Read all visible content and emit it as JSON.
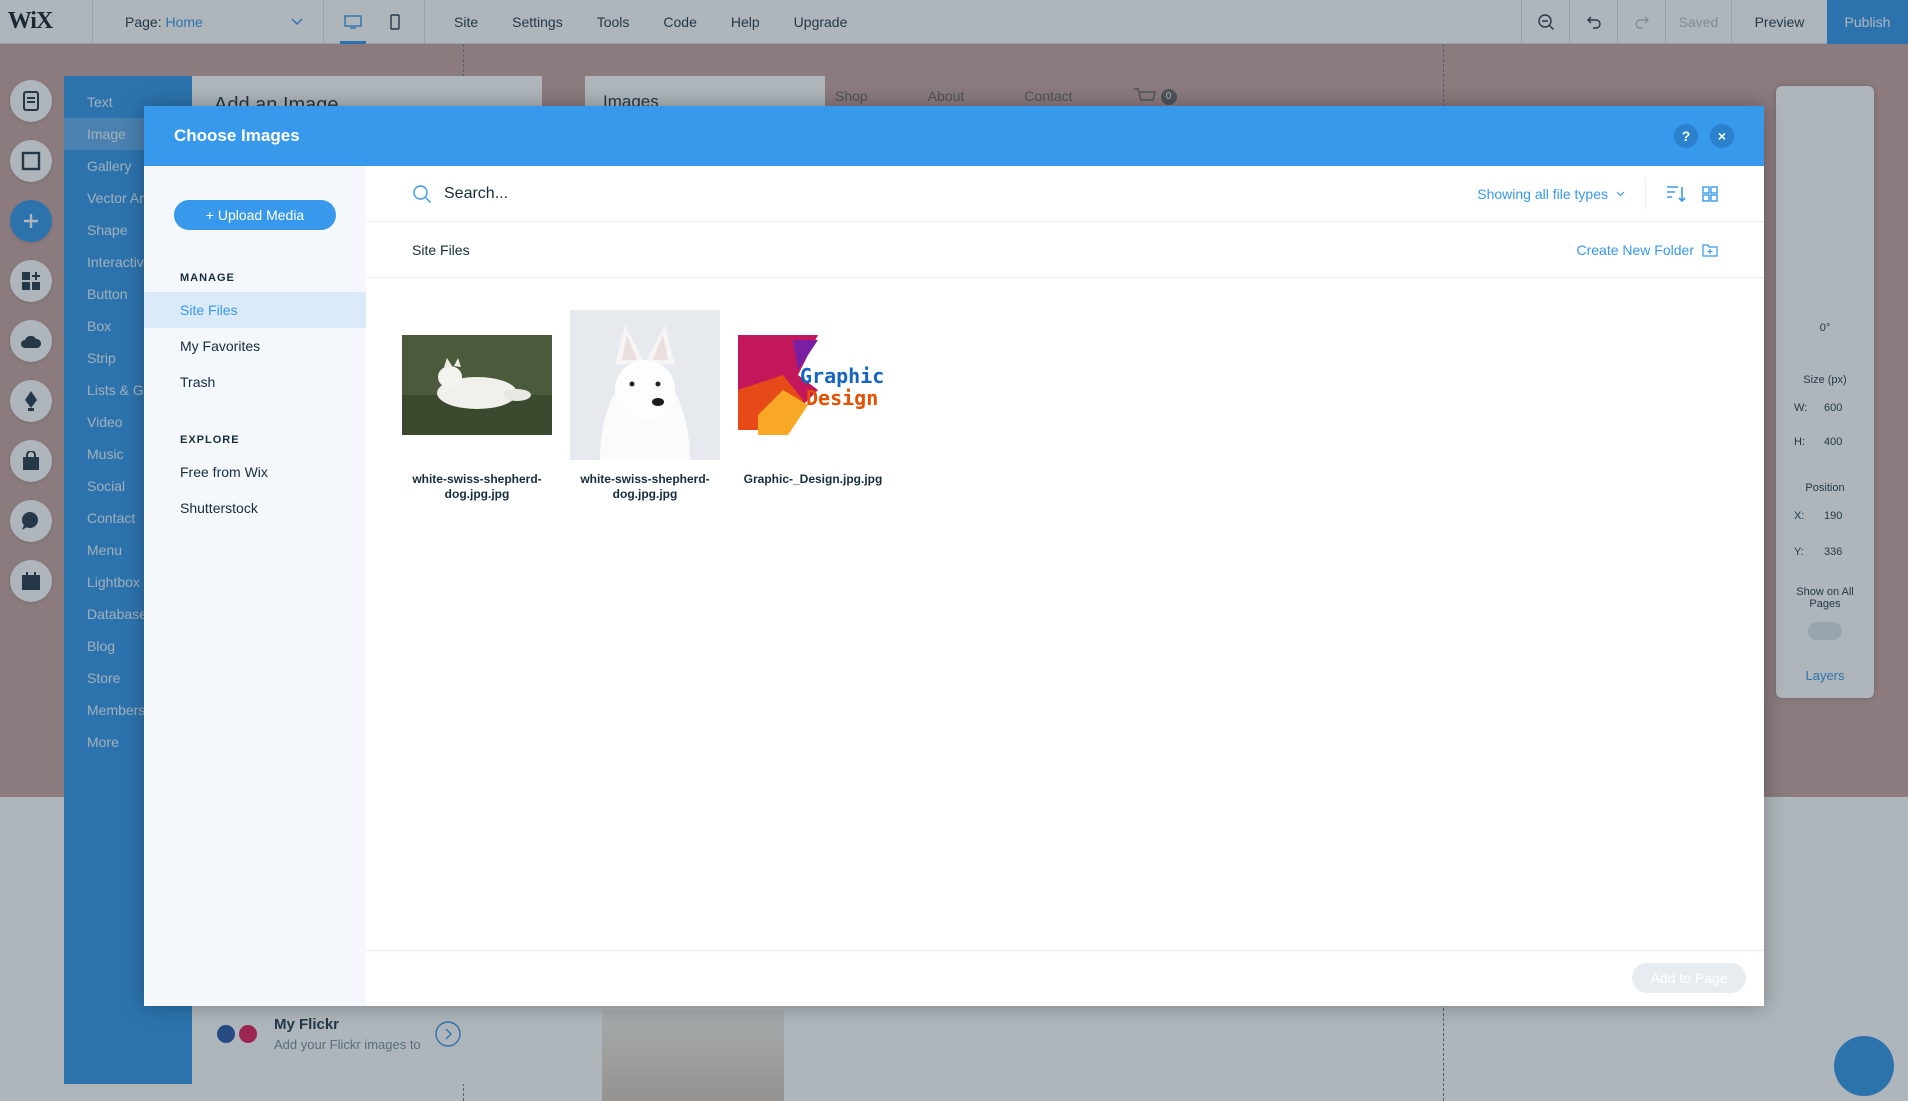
{
  "topbar": {
    "logo": "WiX",
    "page_label": "Page:",
    "page_value": "Home",
    "menu": [
      "Site",
      "Settings",
      "Tools",
      "Code",
      "Help",
      "Upgrade"
    ],
    "saved": "Saved",
    "preview": "Preview",
    "publish": "Publish"
  },
  "add_panel": {
    "items": [
      "Text",
      "Image",
      "Gallery",
      "Vector Ar",
      "Shape",
      "Interactiv",
      "Button",
      "Box",
      "Strip",
      "Lists & G",
      "Video",
      "Music",
      "Social",
      "Contact",
      "Menu",
      "Lightbox",
      "Database",
      "Blog",
      "Store",
      "Members",
      "More"
    ],
    "selected": "Image",
    "sub_title": "Add an Image",
    "flickr_title": "My Flickr",
    "flickr_desc": "Add your Flickr images to"
  },
  "image_panel_title": "Images",
  "site_nav": [
    "Shop",
    "About",
    "Contact"
  ],
  "cart_count": "0",
  "inspector": {
    "angle": "0°",
    "size_title": "Size (px)",
    "w_label": "W:",
    "w_value": "600",
    "h_label": "H:",
    "h_value": "400",
    "position_title": "Position",
    "x_label": "X:",
    "x_value": "190",
    "y_label": "Y:",
    "y_value": "336",
    "show_all_pages": "Show on All Pages",
    "layers": "Layers"
  },
  "modal": {
    "title": "Choose Images",
    "help": "?",
    "close": "×",
    "upload_button": "+ Upload Media",
    "manage_heading": "MANAGE",
    "manage_items": [
      "Site Files",
      "My Favorites",
      "Trash"
    ],
    "explore_heading": "EXPLORE",
    "explore_items": [
      "Free from Wix",
      "Shutterstock"
    ],
    "search_placeholder": "Search...",
    "file_types": "Showing all file types",
    "breadcrumb": "Site Files",
    "new_folder": "Create New Folder",
    "files": [
      {
        "name": "white-swiss-shepherd-dog.jpg.jpg"
      },
      {
        "name": "white-swiss-shepherd-dog.jpg.jpg"
      },
      {
        "name": "Graphic-_Design.jpg.jpg",
        "art_text_1": "Graphic",
        "art_text_2": "Design"
      }
    ],
    "add_to_page": "Add to Page"
  },
  "colors": {
    "accent": "#3899ec",
    "selected_bg": "#dbeaf9",
    "canvas": "#c9a5a2"
  }
}
